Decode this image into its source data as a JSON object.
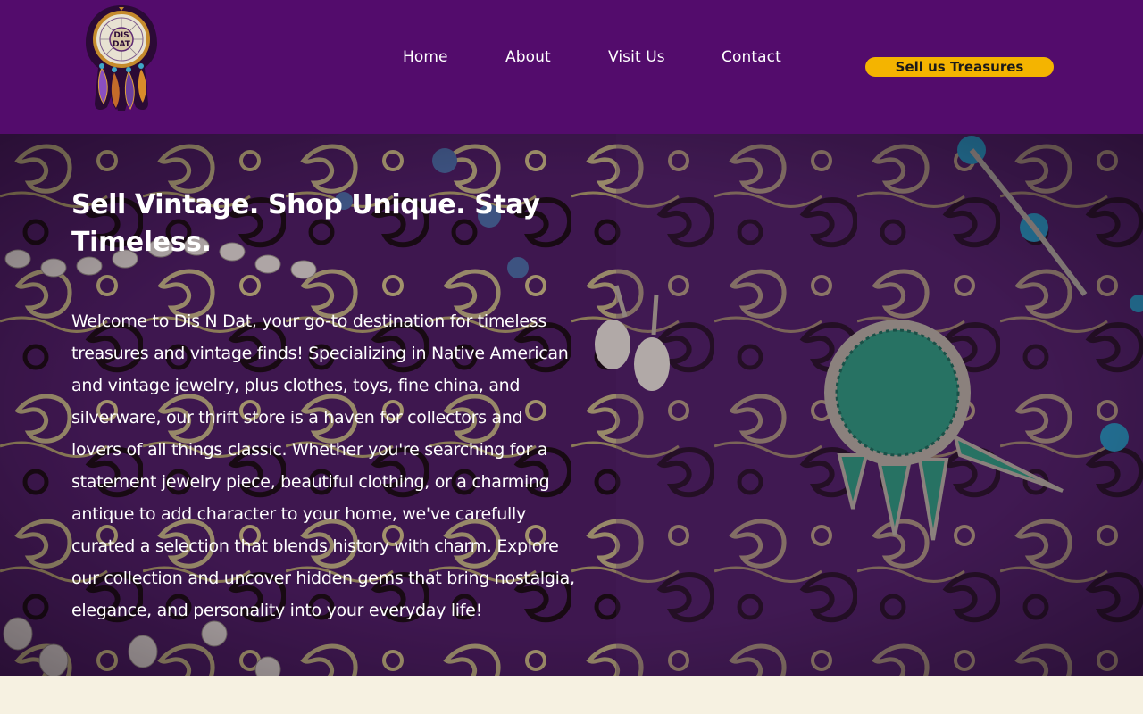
{
  "brand": {
    "logo_text_line1": "DIS",
    "logo_text_line2": "DAT",
    "name": "Dis N Dat"
  },
  "nav": {
    "items": [
      {
        "label": "Home"
      },
      {
        "label": "About"
      },
      {
        "label": "Visit Us"
      },
      {
        "label": "Contact"
      }
    ]
  },
  "cta": {
    "label": "Sell us Treasures"
  },
  "hero": {
    "title": "Sell Vintage. Shop Unique. Stay Timeless.",
    "body": "Welcome to Dis N Dat, your go-to destination for timeless treasures and vintage finds! Specializing in Native American and vintage jewelry, plus clothes, toys, fine china, and silverware, our thrift store is a haven for collectors and lovers of all things classic. Whether you're searching for a statement jewelry piece, beautiful clothing, or a charming antique to add character to your home, we've carefully curated a selection that blends history with charm. Explore our collection and uncover hidden gems that bring nostalgia, elegance, and personality into your everyday life!"
  },
  "colors": {
    "header_bg": "#530c6c",
    "cta_bg": "#f4b400",
    "page_bg": "#f6f1e1",
    "hero_bg": "#4b1e5e"
  }
}
